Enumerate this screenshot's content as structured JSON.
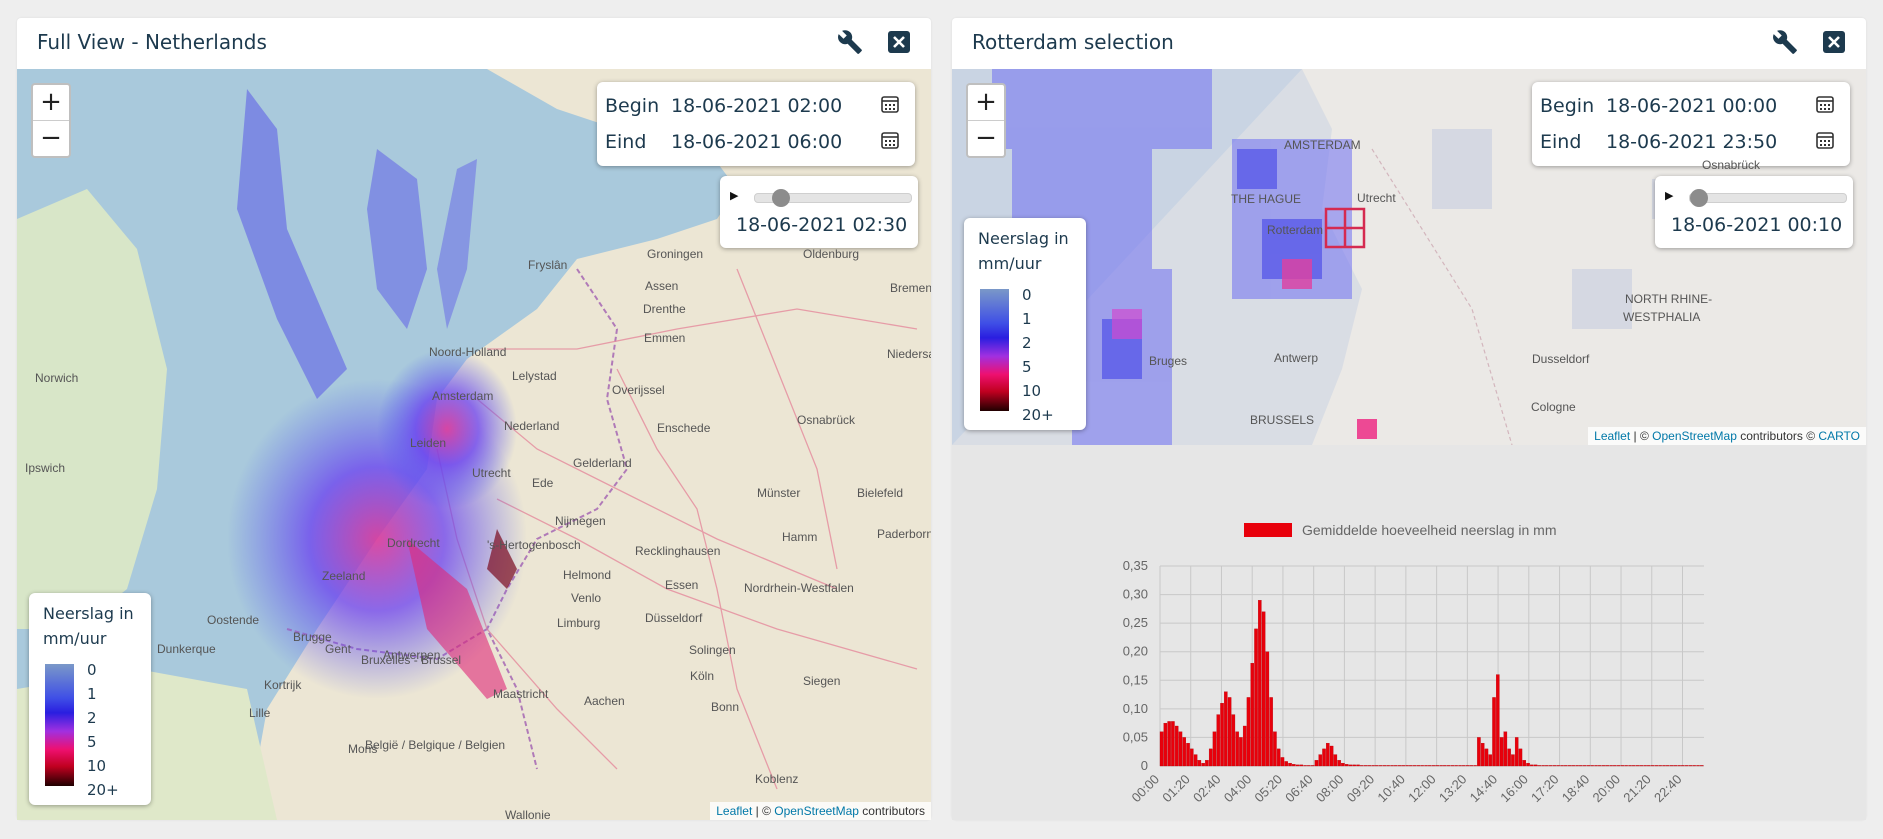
{
  "left_panel": {
    "title": "Full View - Netherlands",
    "begin_label": "Begin",
    "begin_value": "18-06-2021 02:00",
    "end_label": "Eind",
    "end_value": "18-06-2021 06:00",
    "player_time": "18-06-2021 02:30",
    "slider_fraction": 0.125,
    "legend_title": "Neerslag in mm/uur",
    "legend_ticks": [
      "0",
      "1",
      "2",
      "5",
      "10",
      "20+"
    ],
    "attribution_leaflet": "Leaflet",
    "attribution_sep": " | © ",
    "attribution_osm": "OpenStreetMap",
    "attribution_tail": " contributors",
    "map_labels": [
      "Norwich",
      "Ipswich",
      "Fryslân",
      "Groningen",
      "Oldenburg",
      "Assen",
      "Drenthe",
      "Noord-Holland",
      "Lelystad",
      "Emmen",
      "Overijssel",
      "Amsterdam",
      "Nederland",
      "Leiden",
      "Enschede",
      "Osnabrück",
      "Utrecht",
      "Gelderland",
      "Ede",
      "Niedersachsen",
      "Bielefeld",
      "Münster",
      "Dordrecht",
      "Nijmegen",
      "Hamm",
      "Paderborn",
      "'s-Hertogenbosch",
      "Recklinghausen",
      "Zeeland",
      "Helmond",
      "Venlo",
      "Essen",
      "Nordrhein-Westfalen",
      "Oostende",
      "Brugge",
      "Antwerpen",
      "Limburg",
      "Düsseldorf",
      "Dunkerque",
      "Gent",
      "Bruxelles - Brussel",
      "Solingen",
      "Kortrijk",
      "Siegen",
      "Lille",
      "Köln",
      "Maastricht",
      "Aachen",
      "Bonn",
      "Mons",
      "België / Belgique / Belgien",
      "Koblenz",
      "Wallonie",
      "Bremen"
    ]
  },
  "right_panel": {
    "title": "Rotterdam selection",
    "begin_label": "Begin",
    "begin_value": "18-06-2021 00:00",
    "end_label": "Eind",
    "end_value": "18-06-2021 23:50",
    "player_time": "18-06-2021 00:10",
    "slider_fraction": 0.0,
    "legend_title": "Neerslag in mm/uur",
    "legend_ticks": [
      "0",
      "1",
      "2",
      "5",
      "10",
      "20+"
    ],
    "attribution_leaflet": "Leaflet",
    "attribution_sep": " | © ",
    "attribution_osm": "OpenStreetMap",
    "attribution_mid": " contributors © ",
    "attribution_carto": "CARTO",
    "map_labels": [
      "AMSTERDAM",
      "Utrecht",
      "THE HAGUE",
      "Rotterdam",
      "NORTH RHINE-",
      "WESTPHALIA",
      "Bruges",
      "Antwerp",
      "Dusseldorf",
      "Cologne",
      "BRUSSELS",
      "Osnabrück"
    ]
  },
  "icons": {
    "settings": "wrench-icon",
    "close": "close-icon",
    "calendar": "calendar-icon",
    "play": "play-icon"
  },
  "colors": {
    "accent": "#1d3a4e",
    "bar": "#e8000b",
    "link": "#0078a8"
  },
  "chart_data": {
    "type": "bar",
    "legend": "Gemiddelde hoeveelheid neerslag in mm",
    "ylim": [
      0,
      0.35
    ],
    "yticks": [
      "0",
      "0,05",
      "0,10",
      "0,15",
      "0,20",
      "0,25",
      "0,30",
      "0,35"
    ],
    "xticks": [
      "00:00",
      "01:20",
      "02:40",
      "04:00",
      "05:20",
      "06:40",
      "08:00",
      "09:20",
      "10:40",
      "12:00",
      "13:20",
      "14:40",
      "16:00",
      "17:20",
      "18:40",
      "20:00",
      "21:20",
      "22:40"
    ],
    "bar_color": "#e8000b",
    "values": [
      0.06,
      0.075,
      0.078,
      0.078,
      0.07,
      0.06,
      0.05,
      0.04,
      0.03,
      0.02,
      0.01,
      0.005,
      0.01,
      0.03,
      0.06,
      0.09,
      0.11,
      0.13,
      0.12,
      0.09,
      0.06,
      0.05,
      0.07,
      0.12,
      0.18,
      0.24,
      0.29,
      0.27,
      0.2,
      0.12,
      0.06,
      0.03,
      0.015,
      0.008,
      0.005,
      0.003,
      0.002,
      0.002,
      0.001,
      0.001,
      0.001,
      0.01,
      0.02,
      0.03,
      0.04,
      0.035,
      0.02,
      0.01,
      0.005,
      0.003,
      0.002,
      0.002,
      0.002,
      0.001,
      0.001,
      0.001,
      0.001,
      0.001,
      0.001,
      0.001,
      0.001,
      0.001,
      0.001,
      0.001,
      0.001,
      0.001,
      0.001,
      0.001,
      0.001,
      0.001,
      0.001,
      0.001,
      0.001,
      0.001,
      0.001,
      0.001,
      0.001,
      0.001,
      0.001,
      0.001,
      0.001,
      0.001,
      0.001,
      0.001,
      0.05,
      0.04,
      0.03,
      0.02,
      0.12,
      0.16,
      0.05,
      0.06,
      0.03,
      0.02,
      0.05,
      0.03,
      0.01,
      0.005,
      0.002,
      0.002,
      0.001,
      0.001,
      0.001,
      0.001,
      0.001,
      0.001,
      0.001,
      0.001,
      0.001,
      0.001,
      0.001,
      0.001,
      0.001,
      0.001,
      0.001,
      0.001,
      0.001,
      0.001,
      0.001,
      0.001,
      0.001,
      0.001,
      0.001,
      0.001,
      0.001,
      0.001,
      0.001,
      0.001,
      0.001,
      0.001,
      0.001,
      0.001,
      0.001,
      0.001,
      0.001,
      0.001,
      0.001,
      0.001,
      0.001,
      0.001,
      0.001,
      0.001,
      0.001,
      0.001
    ]
  }
}
